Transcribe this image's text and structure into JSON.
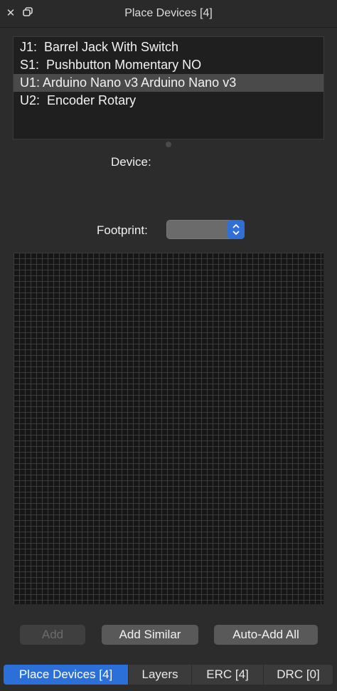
{
  "window": {
    "title": "Place Devices [4]"
  },
  "titlebar_icons": {
    "close": "close-icon",
    "restore": "restore-window-icon"
  },
  "devices": [
    {
      "label": "J1:  Barrel Jack With Switch",
      "selected": false
    },
    {
      "label": "S1:  Pushbutton Momentary NO",
      "selected": false
    },
    {
      "label": "U1: Arduino Nano v3 Arduino Nano v3",
      "selected": true
    },
    {
      "label": "U2:  Encoder Rotary",
      "selected": false
    }
  ],
  "form": {
    "device_label": "Device:",
    "footprint_label": "Footprint:",
    "footprint_value": ""
  },
  "buttons": {
    "add": "Add",
    "add_similar": "Add Similar",
    "auto_add_all": "Auto-Add All"
  },
  "tabs": [
    {
      "label": "Place Devices [4]",
      "active": true
    },
    {
      "label": "Layers",
      "active": false
    },
    {
      "label": "ERC [4]",
      "active": false
    },
    {
      "label": "DRC [0]",
      "active": false
    }
  ],
  "colors": {
    "accent": "#2b6fd8",
    "panel_bg": "#2c2c2c",
    "list_bg": "#1f1f1f",
    "selection": "#4a4a4a"
  }
}
